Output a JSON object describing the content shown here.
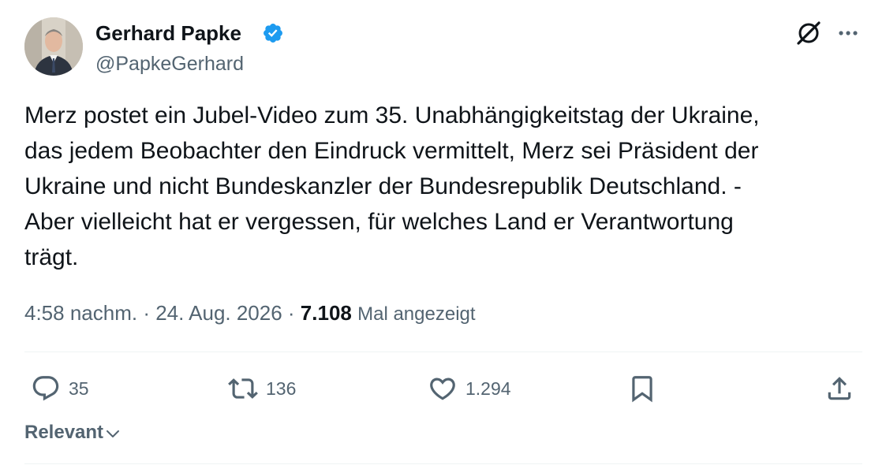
{
  "author": {
    "name": "Gerhard Papke",
    "handle": "@PapkeGerhard",
    "verified": true
  },
  "tweet": {
    "lines": [
      "Merz postet ein Jubel-Video zum 35. Unabhängigkeitstag der Ukraine,",
      "das jedem Beobachter den Eindruck vermittelt, Merz sei Präsident der",
      "Ukraine und nicht Bundeskanzler der Bundesrepublik Deutschland. -",
      "Aber vielleicht hat er vergessen, für welches Land er Verantwortung",
      "trägt."
    ]
  },
  "meta": {
    "time": "4:58 nachm.",
    "separator": " · ",
    "date": "24. Aug. 2026",
    "views_count": "7.108",
    "views_label": "Mal angezeigt"
  },
  "actions": {
    "replies": "35",
    "retweets": "136",
    "likes": "1.294"
  },
  "sort": {
    "label": "Relevant"
  },
  "colors": {
    "text": "#0f1419",
    "secondary": "#536471",
    "verified": "#1d9bf0",
    "divider": "#eff3f4"
  },
  "icons": {
    "grok": "grok-icon",
    "more": "more-icon",
    "reply": "reply-icon",
    "retweet": "retweet-icon",
    "like": "heart-icon",
    "bookmark": "bookmark-icon",
    "share": "share-icon",
    "verified": "verified-badge-icon",
    "chevron": "chevron-down-icon"
  }
}
